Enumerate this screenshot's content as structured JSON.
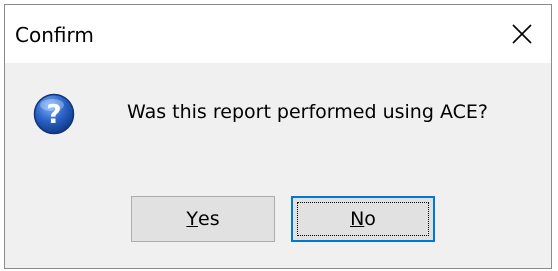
{
  "window": {
    "title": "Confirm",
    "close_icon": "close-icon"
  },
  "dialog": {
    "icon": "question-icon",
    "message": "Was this report performed using ACE?"
  },
  "buttons": {
    "yes": {
      "mnemonic": "Y",
      "rest": "es"
    },
    "no": {
      "mnemonic": "N",
      "rest": "o"
    }
  },
  "colors": {
    "icon_blue": "#2a63c7",
    "focus_border": "#0078d7",
    "button_face": "#e1e1e1",
    "dialog_bg": "#f0f0f0"
  }
}
